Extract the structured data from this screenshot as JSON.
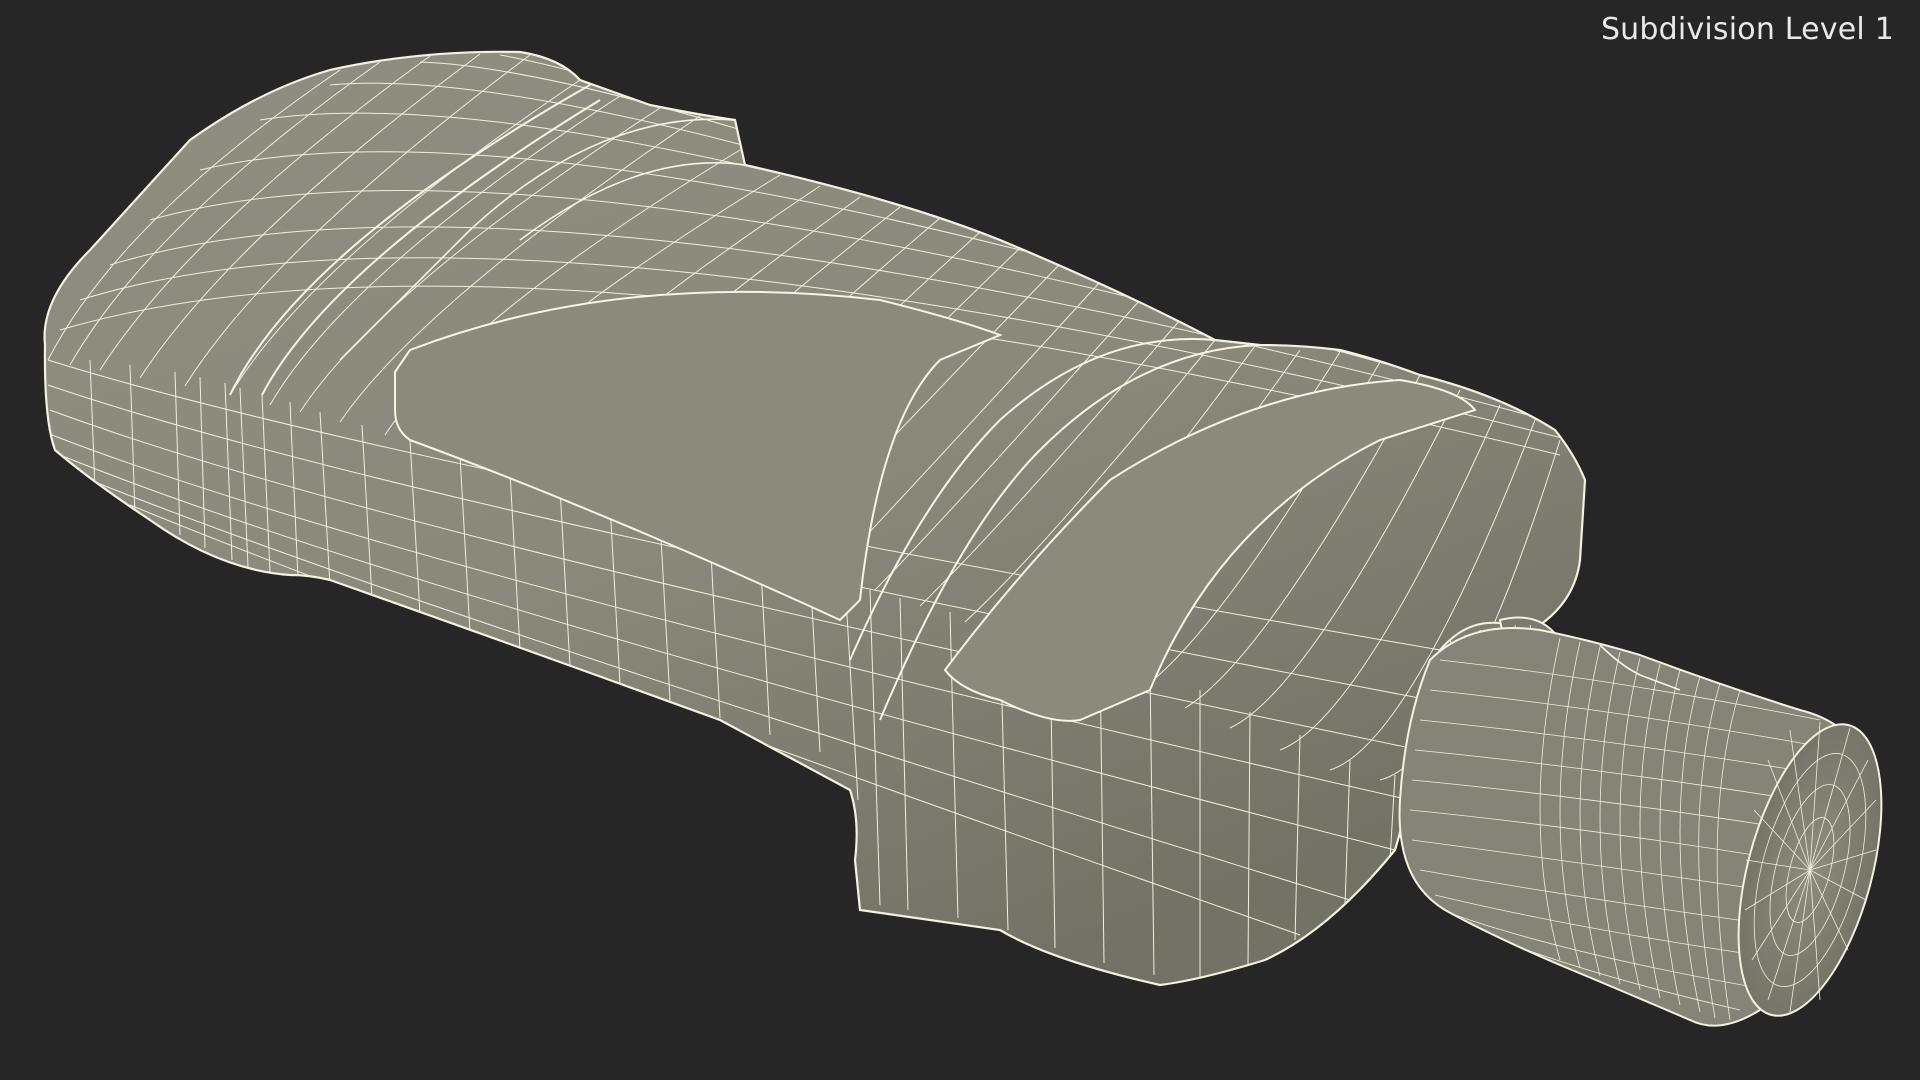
{
  "viewport": {
    "label": "Subdivision Level 1",
    "background": "#262626",
    "model_fill": "#8c8b7e",
    "model_fill_dark": "#6f6e63",
    "wire_color": "#f4f1df"
  }
}
